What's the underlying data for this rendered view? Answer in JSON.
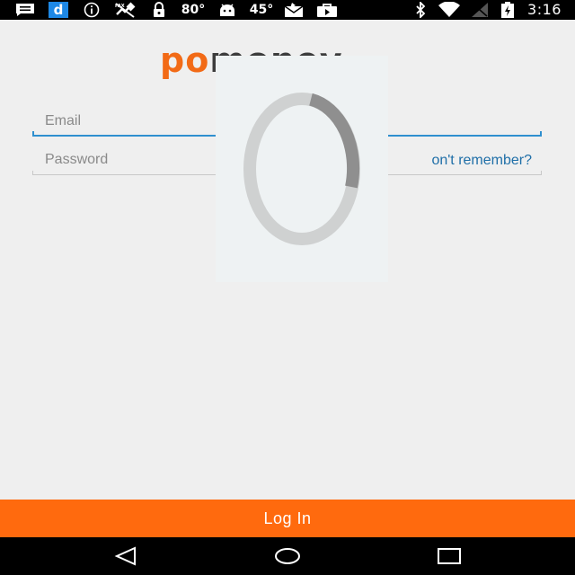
{
  "status_bar": {
    "battery_temp": "80°",
    "cpu_temp": "45°",
    "time": "3:16",
    "icons": [
      "message-icon",
      "d-app-icon",
      "info-icon",
      "gps-off-icon",
      "lock-icon",
      "android-icon",
      "mail-icon",
      "play-store-icon",
      "bluetooth-icon",
      "wifi-icon",
      "no-signal-icon",
      "battery-charging-icon"
    ],
    "colors": {
      "d_app_blue": "#1e88e5"
    }
  },
  "logo": {
    "part1": "po",
    "part2": "money",
    "colors": {
      "primary": "#f26a16",
      "secondary": "#3c3c3c"
    }
  },
  "form": {
    "email_placeholder": "Email",
    "email_value": "",
    "password_placeholder": "Password",
    "password_value": "",
    "forgot_label": "on't remember?",
    "colors": {
      "focus_underline": "#2f8fcf",
      "link": "#1f6fa8"
    }
  },
  "loading": {
    "icon": "spinner-icon"
  },
  "login_button": {
    "label": "Log In",
    "color": "#ff6a0e"
  },
  "nav_bar": {
    "icons": [
      "back-icon",
      "home-icon",
      "recents-icon"
    ]
  }
}
